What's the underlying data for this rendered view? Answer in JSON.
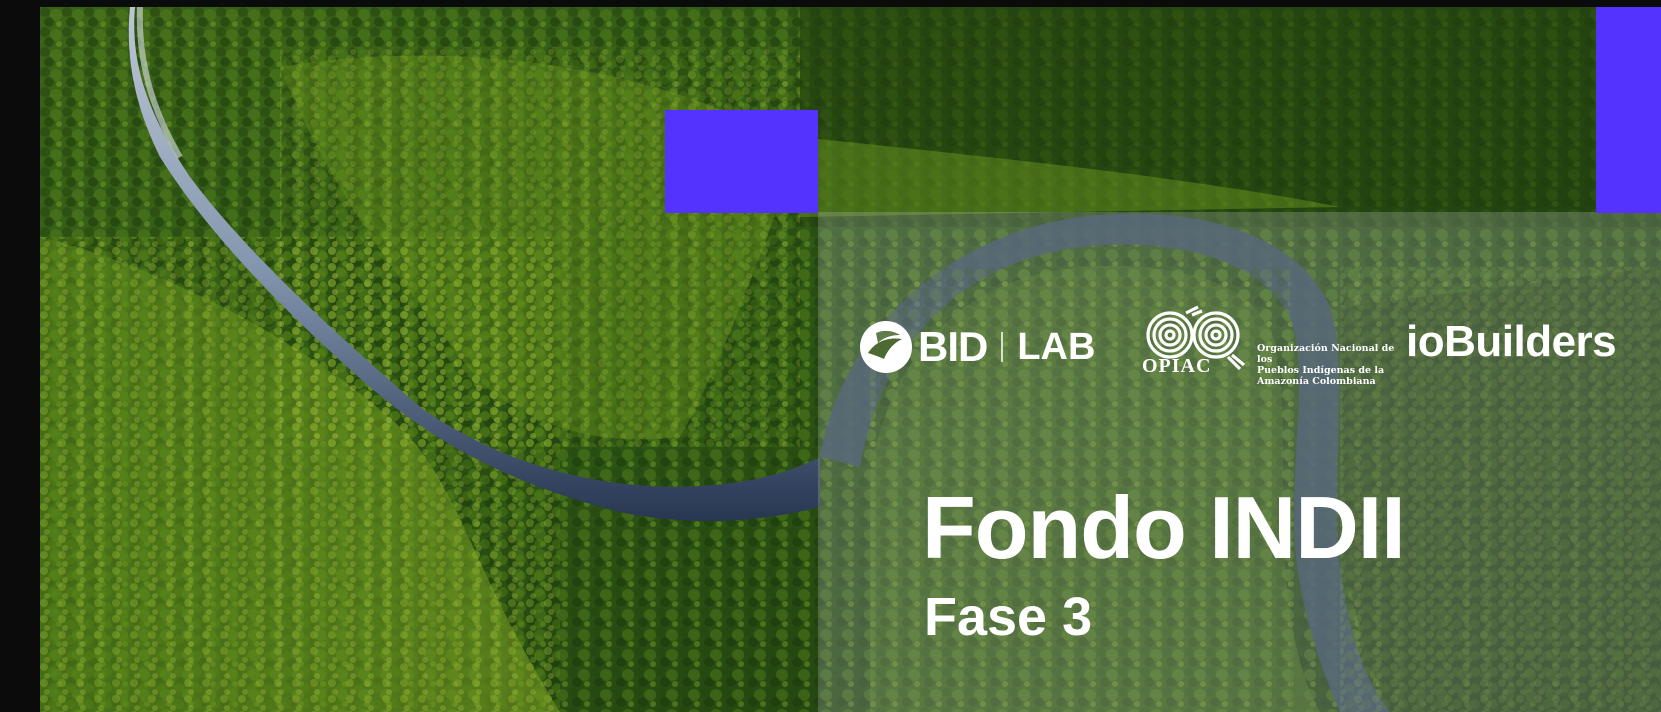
{
  "slide": {
    "title": "Fondo INDII",
    "subtitle": "Fase 3",
    "accent_color": "#5533FF",
    "background_image": "aerial-forest-river-photo"
  },
  "logos": {
    "bid": {
      "name": "BID",
      "lab": "LAB",
      "icon": "bid-leaf-icon"
    },
    "opiac": {
      "name": "OPIAC",
      "description_lines": [
        "Organización Nacional de los",
        "Pueblos Indígenas de la",
        "Amazonía Colombiana"
      ],
      "icon": "opiac-spiral-icon"
    },
    "iobuilders": {
      "name": "ioBuilders"
    }
  }
}
